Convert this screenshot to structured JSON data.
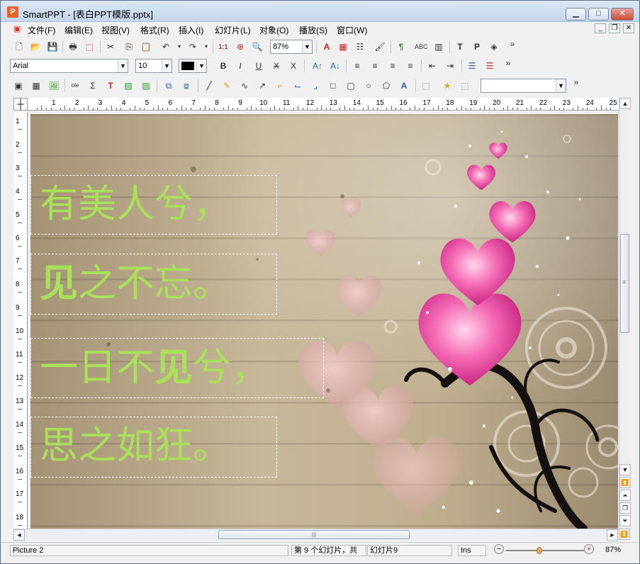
{
  "window": {
    "app_icon_letter": "P",
    "title": "SmartPPT - [表白PPT模版.pptx]",
    "min": "▁",
    "max": "□",
    "close": "✕",
    "mdi_min": "_",
    "mdi_restore": "❐",
    "mdi_close": "✕"
  },
  "menu": [
    "文件(F)",
    "编辑(E)",
    "视图(V)",
    "格式(R)",
    "插入(I)",
    "幻灯片(L)",
    "对象(O)",
    "播放(S)",
    "窗口(W)"
  ],
  "toolbar1": {
    "icons": [
      "new-doc",
      "open-folder",
      "save",
      "print",
      "pdf-export",
      "cut",
      "copy",
      "paste",
      "undo",
      "redo",
      "slide-number",
      "zoom-page",
      "magnifier"
    ],
    "zoom_value": "87%",
    "icons2": [
      "font-color",
      "insert-table",
      "list-outline",
      "format-brush",
      "paragraph-mark",
      "spellcheck",
      "chart",
      "frame-t",
      "frame-p",
      "layers"
    ],
    "overflow": "»"
  },
  "toolbar2": {
    "font": "Arial",
    "size": "10",
    "buttons": [
      "B",
      "I",
      "U",
      "X",
      "X",
      "A↑",
      "A↓",
      "≡",
      "≡",
      "≡",
      "≡",
      "⇤",
      "⇥",
      "☰",
      "☰"
    ],
    "overflow": "»"
  },
  "toolbar3": {
    "overflow": "»",
    "style_value": ""
  },
  "ruler": {
    "corner": "┼",
    "h_labels": [
      "1",
      "2",
      "3",
      "4",
      "5",
      "6",
      "7",
      "8",
      "9",
      "10",
      "11",
      "12",
      "13",
      "14",
      "15",
      "16",
      "17",
      "18",
      "19",
      "20",
      "21",
      "22",
      "23",
      "24",
      "25"
    ],
    "v_labels": [
      "1",
      "2",
      "3",
      "4",
      "5",
      "6",
      "7",
      "8",
      "9",
      "10",
      "11",
      "12",
      "13",
      "14",
      "15",
      "16",
      "17",
      "18"
    ]
  },
  "slide": {
    "lines": [
      {
        "parts": [
          {
            "t": "有美人兮，",
            "b": false
          }
        ]
      },
      {
        "parts": [
          {
            "t": "见",
            "b": true
          },
          {
            "t": "之不忘。",
            "b": false
          }
        ]
      },
      {
        "parts": [
          {
            "t": "一日不",
            "b": false
          },
          {
            "t": "见",
            "b": true
          },
          {
            "t": "兮，",
            "b": false
          }
        ]
      },
      {
        "parts": [
          {
            "t": "思之如狂。",
            "b": false
          }
        ]
      }
    ],
    "text_color": "#a8e05a"
  },
  "scroll": {
    "up": "▲",
    "down": "▼",
    "left": "◄",
    "right": "►",
    "first": "⏫",
    "prev": "⏶",
    "page": "❐",
    "next": "⏷",
    "last": "⏬",
    "grip": "≡",
    "hgrip": "|||"
  },
  "status": {
    "object": "Picture 2",
    "position": "第 9 个幻灯片，共",
    "slide_name": "幻灯片9",
    "mode": "Ins",
    "zoom_minus": "−",
    "zoom_plus": "+",
    "zoom": "87%"
  }
}
